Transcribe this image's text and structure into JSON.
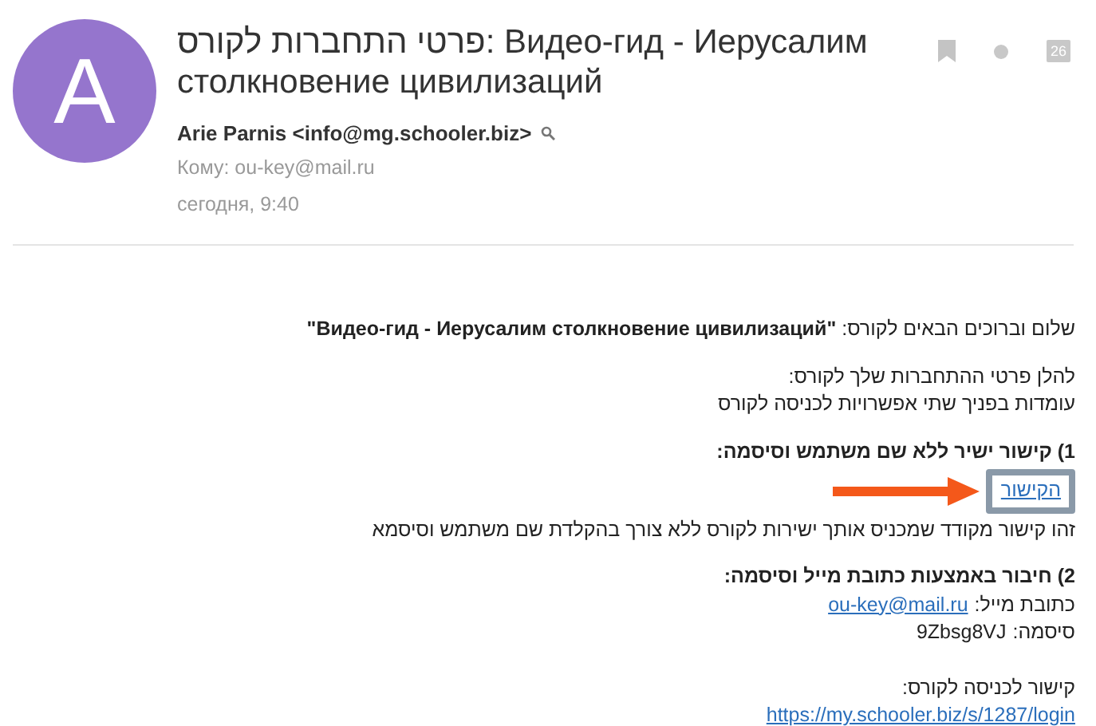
{
  "header": {
    "avatar_letter": "A",
    "subject_lines": [
      "פרטי התחברות לקורס: Видео-гид - Иерусалим",
      "столкновение цивилизаций"
    ],
    "sender": "Arie Parnis <info@mg.schooler.biz>",
    "to": "Кому: ou-key@mail.ru",
    "date": "сегодня, 9:40",
    "calendar_day": "26"
  },
  "body": [
    {
      "kind": "text",
      "parts": [
        "שלום וברוכים הבאים לקורס: **\"Видео-гид - Иерусалим столкновение цивилизаций\"**"
      ]
    },
    {
      "kind": "text",
      "parts": [
        "להלן פרטי ההתחברות שלך לקורס:",
        "עומדות בפניך שתי אפשרויות לכניסה לקורס"
      ]
    },
    {
      "kind": "heading",
      "parts": [
        "1) קישור ישיר ללא שם משתמש וסיסמה:"
      ]
    },
    {
      "kind": "link",
      "parts": [
        "הקישור"
      ]
    },
    {
      "kind": "text",
      "parts": [
        "זהו קישור מקודד שמכניס אותך ישירות לקורס ללא צורך בהקלדת שם משתמש וסיסמא"
      ]
    },
    {
      "kind": "heading",
      "parts": [
        "2) חיבור באמצעות כתובת מייל וסיסמה:"
      ]
    },
    {
      "kind": "field",
      "label": "כתובת מייל:",
      "value": "ou-key@mail.ru",
      "link": true
    },
    {
      "kind": "field",
      "label": "סיסמה:",
      "value": "9Zbsg8VJ",
      "link": false
    },
    {
      "kind": "spacer"
    },
    {
      "kind": "labeled_link",
      "label": "קישור לכניסה לקורס:",
      "url": "https://my.schooler.biz/s/1287/login"
    }
  ]
}
